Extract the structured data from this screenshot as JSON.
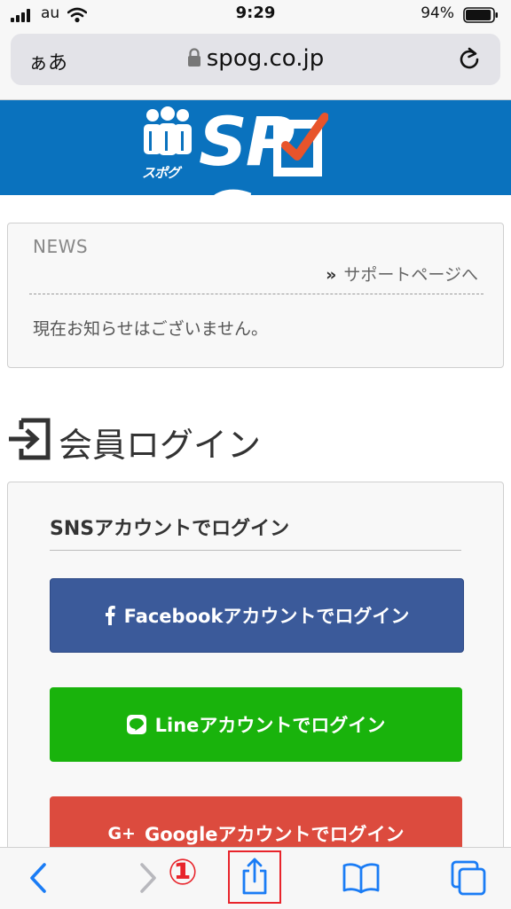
{
  "status_bar": {
    "carrier": "au",
    "time": "9:29",
    "battery_percent": "94%",
    "battery_level": 0.94
  },
  "browser": {
    "reader_label": "ぁあ",
    "url": "spog.co.jp"
  },
  "brand": {
    "logo_text": "SP",
    "logo_text_end": "G",
    "logo_subtext": "スポグ",
    "banner_color": "#0a72be"
  },
  "news": {
    "title": "NEWS",
    "support_link": "サポートページへ",
    "message": "現在お知らせはございません。"
  },
  "login": {
    "heading": "会員ログイン",
    "sns_title": "SNSアカウントでログイン",
    "facebook_label": "Facebookアカウントでログイン",
    "line_label": "Lineアカウントでログイン",
    "google_label": "Googleアカウントでログイン",
    "google_icon_text": "G+",
    "facebook_color": "#3b5a9a",
    "line_color": "#19b30c",
    "google_color": "#dc4b3e"
  },
  "toolbar": {
    "step_marker": "①",
    "icons": [
      "back-icon",
      "forward-icon",
      "share-icon",
      "bookmarks-icon",
      "tabs-icon"
    ],
    "accent_color": "#1a7cf5",
    "highlight_color": "#e8242b"
  }
}
